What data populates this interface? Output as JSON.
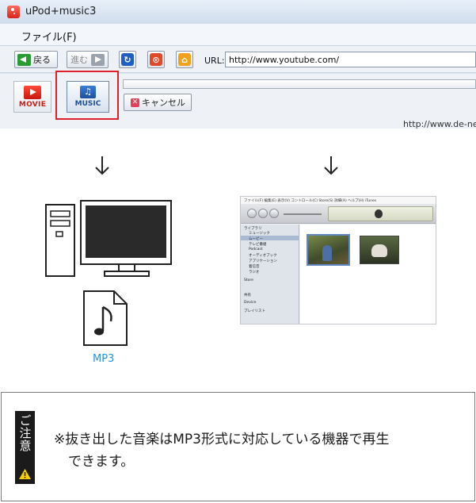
{
  "window": {
    "title": "uPod+music3",
    "menu_file": "ファイル(F)"
  },
  "navbar": {
    "back_label": "戻る",
    "forward_label": "進む",
    "url_label": "URL:",
    "url_value": "http://www.youtube.com/"
  },
  "toolbar": {
    "movie_label": "MOVIE",
    "music_label": "MUSIC",
    "cancel_label": "キャンセル",
    "status_url": "http://www.de-ne"
  },
  "illustration": {
    "mp3_label": "MP3"
  },
  "itunes": {
    "menu_text": "ファイル(F)  編集(E)  表示(V)  コントロール(C)  Store(S)  詳細(A)  ヘルプ(H)       iTunes",
    "sidebar_items": [
      "ライブラリ",
      "ミュージック",
      "ムービー",
      "テレビ番組",
      "Podcast",
      "オーディオブック",
      "アプリケーション",
      "着信音",
      "ラジオ",
      "Store",
      "共有",
      "Device",
      "プレイリスト"
    ]
  },
  "caution": {
    "tag": "ご注意",
    "line1": "※抜き出した音楽はMP3形式に対応している機器で再生",
    "line2": "できます。"
  },
  "colors": {
    "highlight": "#e0202a",
    "mp3_text": "#2a90d8",
    "tag_bg": "#1b1b1b",
    "warn_yellow": "#f5d100"
  },
  "icons": {
    "app": "app-icon",
    "back": "arrow-left-icon",
    "forward": "arrow-right-icon",
    "refresh": "refresh-icon",
    "stop": "stop-icon",
    "home": "home-icon",
    "movie": "movie-icon",
    "music": "music-note-icon",
    "cancel": "close-icon",
    "caution": "warning-icon"
  }
}
